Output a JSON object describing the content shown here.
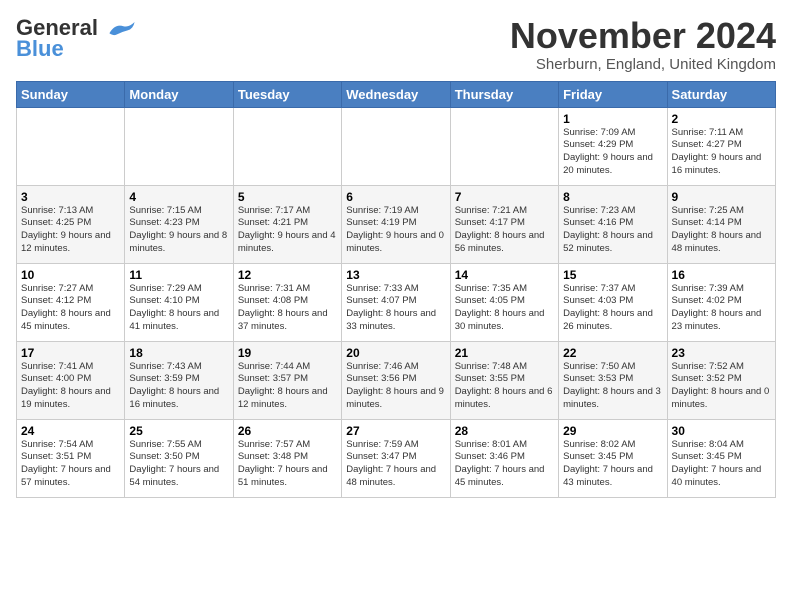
{
  "logo": {
    "line1": "General",
    "line2": "Blue"
  },
  "title": "November 2024",
  "subtitle": "Sherburn, England, United Kingdom",
  "days_of_week": [
    "Sunday",
    "Monday",
    "Tuesday",
    "Wednesday",
    "Thursday",
    "Friday",
    "Saturday"
  ],
  "weeks": [
    [
      {
        "day": "",
        "info": ""
      },
      {
        "day": "",
        "info": ""
      },
      {
        "day": "",
        "info": ""
      },
      {
        "day": "",
        "info": ""
      },
      {
        "day": "",
        "info": ""
      },
      {
        "day": "1",
        "info": "Sunrise: 7:09 AM\nSunset: 4:29 PM\nDaylight: 9 hours and 20 minutes."
      },
      {
        "day": "2",
        "info": "Sunrise: 7:11 AM\nSunset: 4:27 PM\nDaylight: 9 hours and 16 minutes."
      }
    ],
    [
      {
        "day": "3",
        "info": "Sunrise: 7:13 AM\nSunset: 4:25 PM\nDaylight: 9 hours and 12 minutes."
      },
      {
        "day": "4",
        "info": "Sunrise: 7:15 AM\nSunset: 4:23 PM\nDaylight: 9 hours and 8 minutes."
      },
      {
        "day": "5",
        "info": "Sunrise: 7:17 AM\nSunset: 4:21 PM\nDaylight: 9 hours and 4 minutes."
      },
      {
        "day": "6",
        "info": "Sunrise: 7:19 AM\nSunset: 4:19 PM\nDaylight: 9 hours and 0 minutes."
      },
      {
        "day": "7",
        "info": "Sunrise: 7:21 AM\nSunset: 4:17 PM\nDaylight: 8 hours and 56 minutes."
      },
      {
        "day": "8",
        "info": "Sunrise: 7:23 AM\nSunset: 4:16 PM\nDaylight: 8 hours and 52 minutes."
      },
      {
        "day": "9",
        "info": "Sunrise: 7:25 AM\nSunset: 4:14 PM\nDaylight: 8 hours and 48 minutes."
      }
    ],
    [
      {
        "day": "10",
        "info": "Sunrise: 7:27 AM\nSunset: 4:12 PM\nDaylight: 8 hours and 45 minutes."
      },
      {
        "day": "11",
        "info": "Sunrise: 7:29 AM\nSunset: 4:10 PM\nDaylight: 8 hours and 41 minutes."
      },
      {
        "day": "12",
        "info": "Sunrise: 7:31 AM\nSunset: 4:08 PM\nDaylight: 8 hours and 37 minutes."
      },
      {
        "day": "13",
        "info": "Sunrise: 7:33 AM\nSunset: 4:07 PM\nDaylight: 8 hours and 33 minutes."
      },
      {
        "day": "14",
        "info": "Sunrise: 7:35 AM\nSunset: 4:05 PM\nDaylight: 8 hours and 30 minutes."
      },
      {
        "day": "15",
        "info": "Sunrise: 7:37 AM\nSunset: 4:03 PM\nDaylight: 8 hours and 26 minutes."
      },
      {
        "day": "16",
        "info": "Sunrise: 7:39 AM\nSunset: 4:02 PM\nDaylight: 8 hours and 23 minutes."
      }
    ],
    [
      {
        "day": "17",
        "info": "Sunrise: 7:41 AM\nSunset: 4:00 PM\nDaylight: 8 hours and 19 minutes."
      },
      {
        "day": "18",
        "info": "Sunrise: 7:43 AM\nSunset: 3:59 PM\nDaylight: 8 hours and 16 minutes."
      },
      {
        "day": "19",
        "info": "Sunrise: 7:44 AM\nSunset: 3:57 PM\nDaylight: 8 hours and 12 minutes."
      },
      {
        "day": "20",
        "info": "Sunrise: 7:46 AM\nSunset: 3:56 PM\nDaylight: 8 hours and 9 minutes."
      },
      {
        "day": "21",
        "info": "Sunrise: 7:48 AM\nSunset: 3:55 PM\nDaylight: 8 hours and 6 minutes."
      },
      {
        "day": "22",
        "info": "Sunrise: 7:50 AM\nSunset: 3:53 PM\nDaylight: 8 hours and 3 minutes."
      },
      {
        "day": "23",
        "info": "Sunrise: 7:52 AM\nSunset: 3:52 PM\nDaylight: 8 hours and 0 minutes."
      }
    ],
    [
      {
        "day": "24",
        "info": "Sunrise: 7:54 AM\nSunset: 3:51 PM\nDaylight: 7 hours and 57 minutes."
      },
      {
        "day": "25",
        "info": "Sunrise: 7:55 AM\nSunset: 3:50 PM\nDaylight: 7 hours and 54 minutes."
      },
      {
        "day": "26",
        "info": "Sunrise: 7:57 AM\nSunset: 3:48 PM\nDaylight: 7 hours and 51 minutes."
      },
      {
        "day": "27",
        "info": "Sunrise: 7:59 AM\nSunset: 3:47 PM\nDaylight: 7 hours and 48 minutes."
      },
      {
        "day": "28",
        "info": "Sunrise: 8:01 AM\nSunset: 3:46 PM\nDaylight: 7 hours and 45 minutes."
      },
      {
        "day": "29",
        "info": "Sunrise: 8:02 AM\nSunset: 3:45 PM\nDaylight: 7 hours and 43 minutes."
      },
      {
        "day": "30",
        "info": "Sunrise: 8:04 AM\nSunset: 3:45 PM\nDaylight: 7 hours and 40 minutes."
      }
    ]
  ]
}
